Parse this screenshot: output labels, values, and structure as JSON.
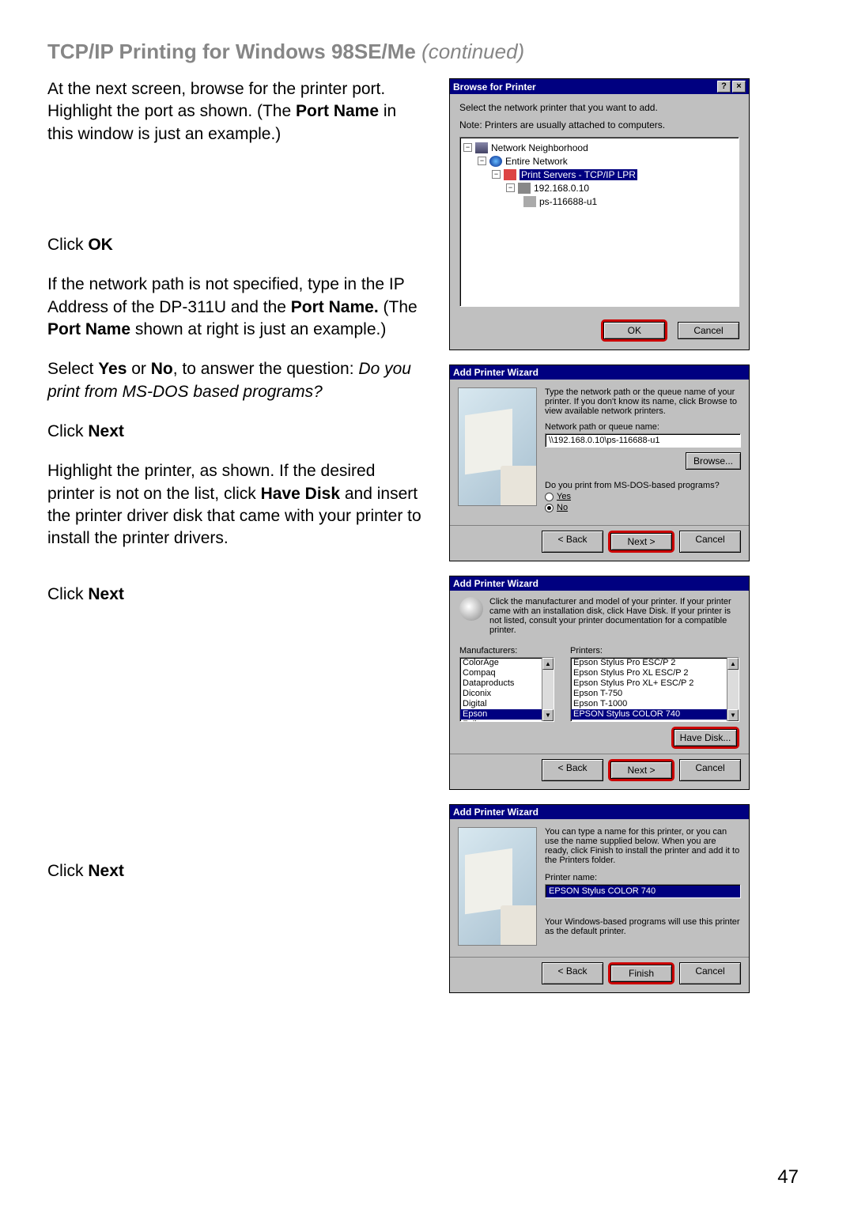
{
  "heading": {
    "title": "TCP/IP Printing for Windows 98SE/Me",
    "cont": " (continued)"
  },
  "left": {
    "p1a": "At the next screen, browse for the printer port. Highlight the port as shown. (The ",
    "p1b": "Port Name",
    "p1c": " in this window is just an example.)",
    "p2a": "Click ",
    "p2b": "OK",
    "p3a": "If the network path is not specified, type in the IP Address of the DP-311U and the ",
    "p3b": "Port Name.",
    "p3c": " (The ",
    "p3d": "Port Name",
    "p3e": " shown at right is just an example.)",
    "p4a": "Select ",
    "p4b": "Yes",
    "p4c": " or ",
    "p4d": "No",
    "p4e": ", to answer the question: ",
    "p4f": "Do you print from MS-DOS based programs?",
    "p5a": "Click ",
    "p5b": "Next",
    "p6a": "Highlight the printer, as shown. If the desired printer is not on the list, click ",
    "p6b": "Have Disk",
    "p6c": " and insert the printer driver disk that came with your printer to install the printer drivers.",
    "p7a": "Click ",
    "p7b": "Next",
    "p8a": "Click ",
    "p8b": "Next"
  },
  "dlg1": {
    "title": "Browse for Printer",
    "help": "?",
    "close": "×",
    "line1": "Select the network printer that you want to add.",
    "line2": "Note: Printers are usually attached to computers.",
    "tree": {
      "n1": "Network Neighborhood",
      "n2": "Entire Network",
      "n3": "Print Servers - TCP/IP LPR",
      "n4": "192.168.0.10",
      "n5": "ps-116688-u1"
    },
    "ok": "OK",
    "cancel": "Cancel"
  },
  "dlg2": {
    "title": "Add Printer Wizard",
    "desc": "Type the network path or the queue name of your printer. If you don't know its name, click Browse to view available network printers.",
    "pathlabel": "Network path or queue name:",
    "pathvalue": "\\\\192.168.0.10\\ps-116688-u1",
    "browse": "Browse...",
    "q": "Do you print from MS-DOS-based programs?",
    "yes": "Yes",
    "no": "No",
    "back": "< Back",
    "next": "Next >",
    "cancel": "Cancel"
  },
  "dlg3": {
    "title": "Add Printer Wizard",
    "desc": "Click the manufacturer and model of your printer. If your printer came with an installation disk, click Have Disk. If your printer is not listed, consult your printer documentation for a compatible printer.",
    "mfg_label": "Manufacturers:",
    "prn_label": "Printers:",
    "mfg": [
      "ColorAge",
      "Compaq",
      "Dataproducts",
      "Diconix",
      "Digital",
      "Epson",
      "Fujitsu"
    ],
    "mfg_sel": 5,
    "prn": [
      "Epson Stylus Pro ESC/P 2",
      "Epson Stylus Pro XL ESC/P 2",
      "Epson Stylus Pro XL+ ESC/P 2",
      "Epson T-750",
      "Epson T-1000",
      "EPSON Stylus COLOR 740"
    ],
    "prn_sel": 5,
    "have": "Have Disk...",
    "back": "< Back",
    "next": "Next >",
    "cancel": "Cancel"
  },
  "dlg4": {
    "title": "Add Printer Wizard",
    "desc": "You can type a name for this printer, or you can use the name supplied below. When you are ready, click Finish to install the printer and add it to the Printers folder.",
    "name_label": "Printer name:",
    "name_value": "EPSON Stylus COLOR 740",
    "note": "Your Windows-based programs will use this printer as the default printer.",
    "back": "< Back",
    "finish": "Finish",
    "cancel": "Cancel"
  },
  "page": "47"
}
